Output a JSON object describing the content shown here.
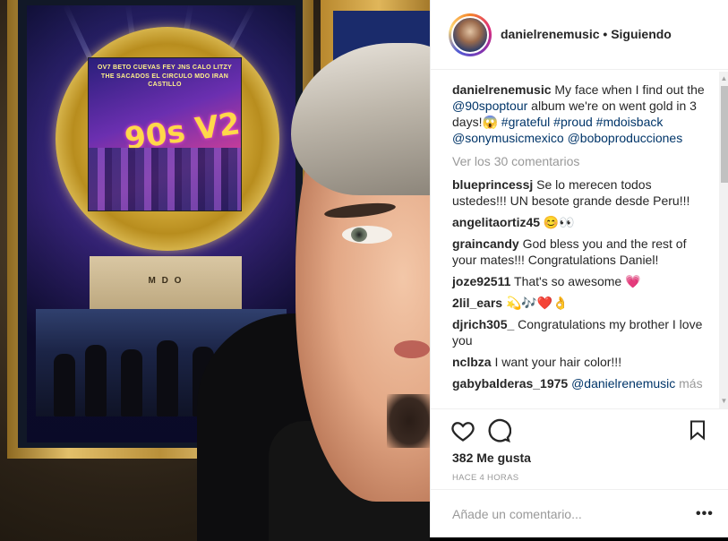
{
  "post": {
    "username": "danielrenemusic",
    "follow_sep": "•",
    "follow_status": "Siguiendo"
  },
  "photo": {
    "album_top_line1": "OV7   BETO CUEVAS   FEY   JNS   CALO   LITZY",
    "album_top_line2": "THE SACADOS  EL CIRCULO  MDO  IRAN CASTILLO",
    "album_logo": "90s V2",
    "plaque_label": "M D O"
  },
  "caption": {
    "username": "danielrenemusic",
    "text_1": " My face when I find out the ",
    "mention_1": "@90spoptour",
    "text_2": " album we're on went gold in 3 days!",
    "emoji": "😱",
    "tag_1": "#grateful",
    "tag_2": "#proud",
    "tag_3": "#mdoisback",
    "mention_2": "@sonymusicmexico",
    "mention_3": "@boboproducciones"
  },
  "view_all_comments": "Ver los 30 comentarios",
  "comments": [
    {
      "user": "blueprincessj",
      "text": "Se lo merecen todos ustedes!!! UN besote grande desde Peru!!!"
    },
    {
      "user": "angelitaortiz45",
      "text": "😊👀"
    },
    {
      "user": "graincandy",
      "text": "God bless you and the rest of your mates!!! Congratulations Daniel!"
    },
    {
      "user": "joze92511",
      "text": "That's so awesome 💗"
    },
    {
      "user": "2lil_ears",
      "text": "💫🎶❤️👌"
    },
    {
      "user": "djrich305_",
      "text": "Congratulations my brother I love you"
    },
    {
      "user": "nclbza",
      "text": "I want your hair color!!!"
    },
    {
      "user": "gabybalderas_1975",
      "mention": "@danielrenemusic",
      "more": "más"
    }
  ],
  "actions": {
    "likes": "382 Me gusta",
    "time": "HACE 4 HORAS"
  },
  "add_comment": {
    "placeholder": "Añade un comentario...",
    "options_label": "•••"
  },
  "icons": {
    "heart": "heart-icon",
    "comment": "comment-icon",
    "bookmark": "bookmark-icon",
    "options": "more-options-icon"
  }
}
